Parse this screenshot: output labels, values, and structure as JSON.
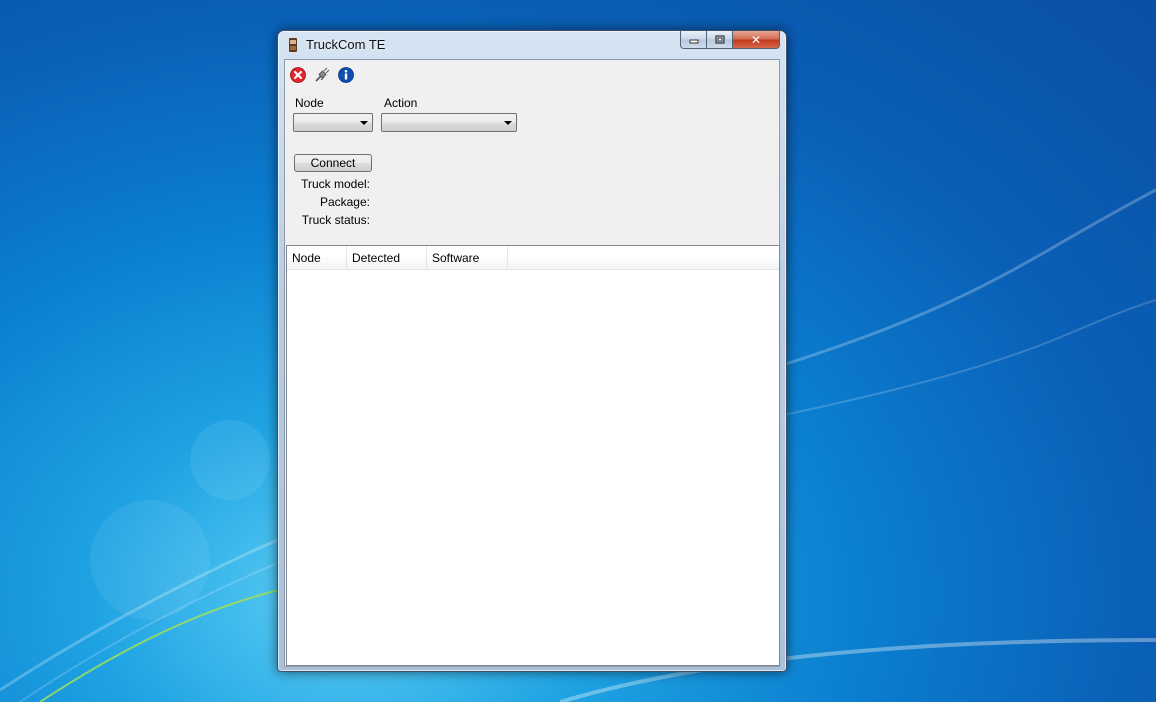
{
  "window": {
    "title": "TruckCom TE"
  },
  "caption_buttons": {
    "minimize": "▭",
    "maximize": "▢",
    "close": "✕"
  },
  "toolbar": {
    "icons": [
      "close-red-icon",
      "connect-plug-icon",
      "info-icon"
    ]
  },
  "form": {
    "node_label": "Node",
    "action_label": "Action",
    "node_value": "",
    "action_value": "",
    "connect_label": "Connect",
    "truck_model_label": "Truck model:",
    "package_label": "Package:",
    "truck_status_label": "Truck status:"
  },
  "list": {
    "columns": [
      "Node",
      "Detected",
      "Software"
    ],
    "rows": []
  },
  "colors": {
    "desktop_blue": "#0b7fd0",
    "close_button_red": "#c2391c",
    "client_bg": "#f0f0f0"
  }
}
